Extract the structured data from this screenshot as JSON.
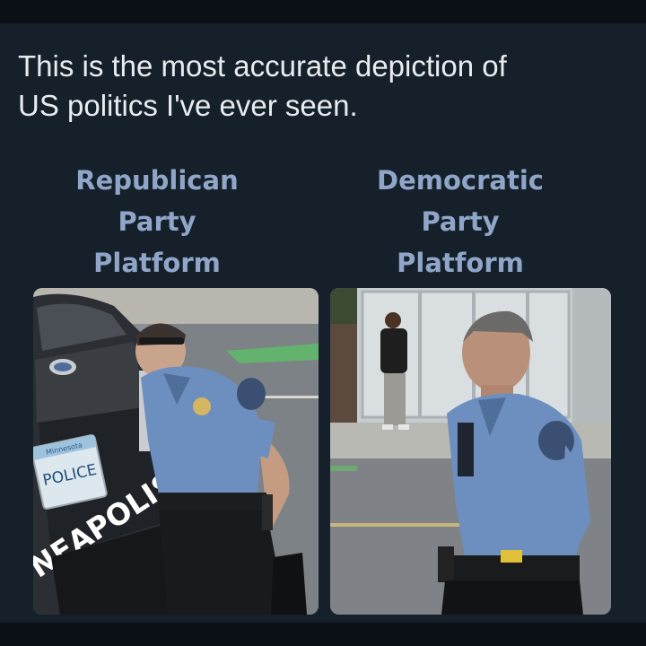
{
  "post": {
    "headline_line1": "This is the most accurate depiction of",
    "headline_line2": "US politics I've ever seen."
  },
  "left_label": {
    "line1": "Republican",
    "line2": "Party",
    "line3": "Platform"
  },
  "right_label": {
    "line1": "Democratic",
    "line2": "Party",
    "line3": "Platform"
  },
  "left_photo": {
    "plate_state": "Minnesota",
    "plate_text": "POLICE",
    "vehicle_text": "NEAPOLIS"
  },
  "colors": {
    "background": "#15202b",
    "headline": "#e8ecef",
    "label": "#8fa6c8",
    "uniform": "#6d8fbf"
  }
}
